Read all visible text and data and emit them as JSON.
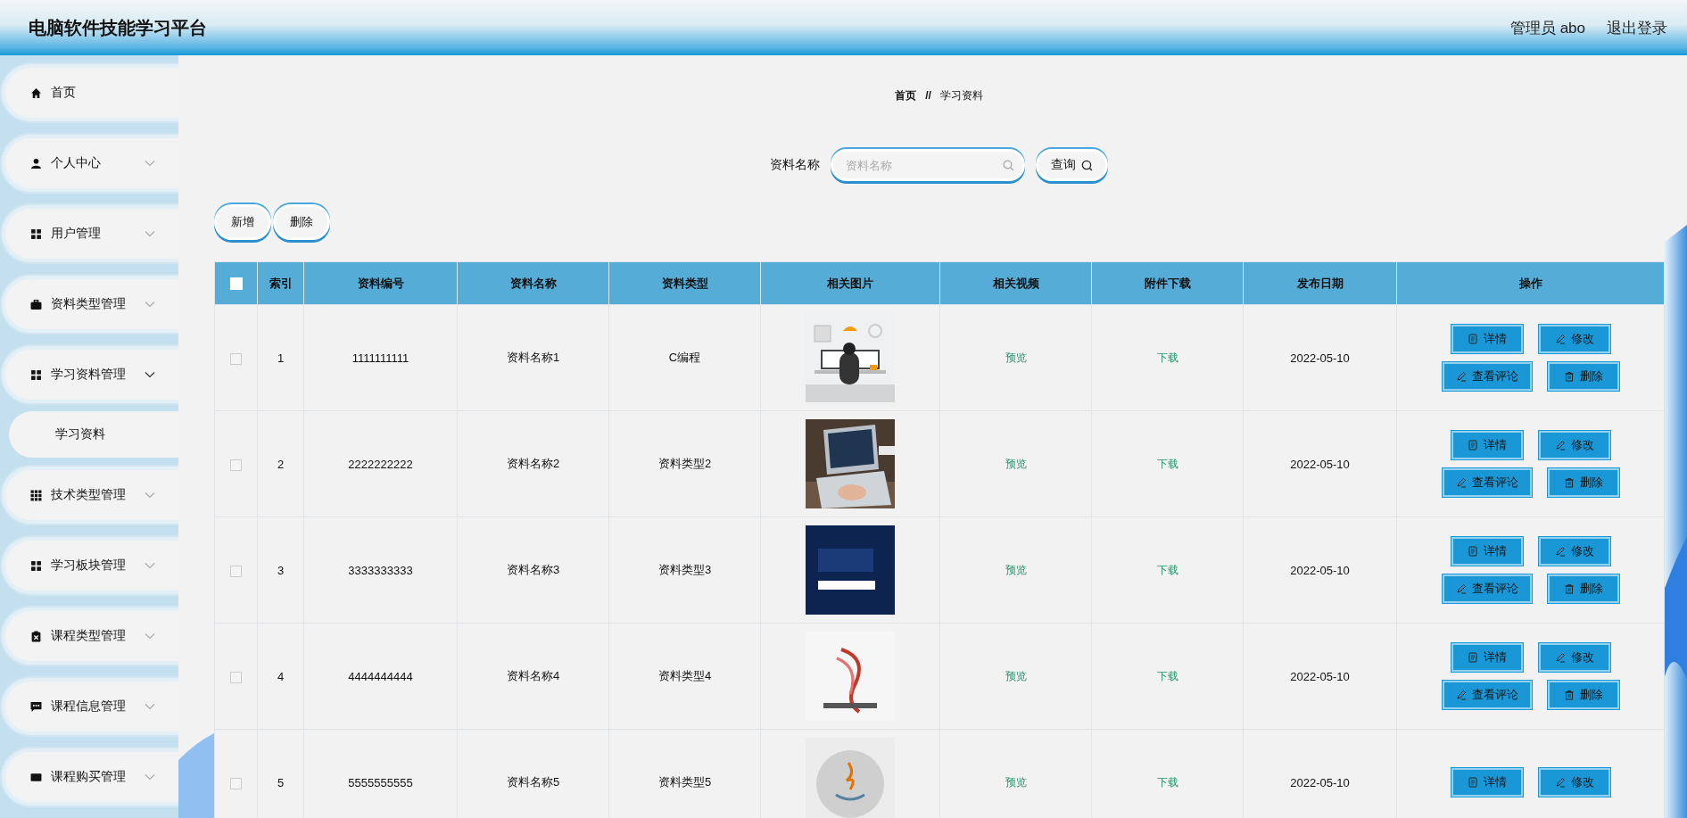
{
  "header": {
    "title": "电脑软件技能学习平台",
    "user": "管理员 abo",
    "logout": "退出登录"
  },
  "sidebar": {
    "items": [
      {
        "label": "首页",
        "kind": "link"
      },
      {
        "label": "个人中心",
        "kind": "menu",
        "expanded": false
      },
      {
        "label": "用户管理",
        "kind": "menu",
        "expanded": false
      },
      {
        "label": "资料类型管理",
        "kind": "menu",
        "expanded": false
      },
      {
        "label": "学习资料管理",
        "kind": "menu",
        "expanded": true,
        "children": [
          {
            "label": "学习资料",
            "selected": true
          }
        ]
      },
      {
        "label": "技术类型管理",
        "kind": "menu",
        "expanded": false
      },
      {
        "label": "学习板块管理",
        "kind": "menu",
        "expanded": false
      },
      {
        "label": "课程类型管理",
        "kind": "menu",
        "expanded": false
      },
      {
        "label": "课程信息管理",
        "kind": "menu",
        "expanded": false
      },
      {
        "label": "课程购买管理",
        "kind": "menu",
        "expanded": false
      }
    ]
  },
  "breadcrumb": {
    "items": [
      "首页",
      "学习资料"
    ],
    "separator": "//"
  },
  "search": {
    "label": "资料名称",
    "placeholder": "资料名称",
    "button": "查询"
  },
  "toolbar": [
    "新增",
    "删除"
  ],
  "table": {
    "select_all": {
      "checked": false
    },
    "columns": [
      "索引",
      "资料编号",
      "资料名称",
      "资料类型",
      "相关图片",
      "相关视频",
      "附件下载",
      "发布日期",
      "操作"
    ],
    "rows": [
      {
        "checked": false,
        "index": "1",
        "code": "1111111111",
        "name": "资料名称1",
        "type": "C编程",
        "picture": {
          "kind": "picture"
        },
        "video": "预览",
        "file": "下载",
        "date": "2022-05-10",
        "actions": [
          {
            "kind": "detail",
            "label": "详情"
          },
          {
            "kind": "edit",
            "label": "修改"
          },
          {
            "kind": "comment",
            "label": "查看评论"
          },
          {
            "kind": "delete",
            "label": "删除"
          }
        ]
      },
      {
        "checked": false,
        "index": "2",
        "code": "2222222222",
        "name": "资料名称2",
        "type": "资料类型2",
        "picture": {
          "kind": "picture"
        },
        "video": "预览",
        "file": "下载",
        "date": "2022-05-10",
        "actions": [
          {
            "kind": "detail",
            "label": "详情"
          },
          {
            "kind": "edit",
            "label": "修改"
          },
          {
            "kind": "comment",
            "label": "查看评论"
          },
          {
            "kind": "delete",
            "label": "删除"
          }
        ]
      },
      {
        "checked": false,
        "index": "3",
        "code": "3333333333",
        "name": "资料名称3",
        "type": "资料类型3",
        "picture": {
          "kind": "picture"
        },
        "video": "预览",
        "file": "下载",
        "date": "2022-05-10",
        "actions": [
          {
            "kind": "detail",
            "label": "详情"
          },
          {
            "kind": "edit",
            "label": "修改"
          },
          {
            "kind": "comment",
            "label": "查看评论"
          },
          {
            "kind": "delete",
            "label": "删除"
          }
        ]
      },
      {
        "checked": false,
        "index": "4",
        "code": "4444444444",
        "name": "资料名称4",
        "type": "资料类型4",
        "picture": {
          "kind": "picture"
        },
        "video": "预览",
        "file": "下载",
        "date": "2022-05-10",
        "actions": [
          {
            "kind": "detail",
            "label": "详情"
          },
          {
            "kind": "edit",
            "label": "修改"
          },
          {
            "kind": "comment",
            "label": "查看评论"
          },
          {
            "kind": "delete",
            "label": "删除"
          }
        ]
      },
      {
        "checked": false,
        "index": "5",
        "code": "5555555555",
        "name": "资料名称5",
        "type": "资料类型5",
        "picture": {
          "kind": "picture"
        },
        "video": "预览",
        "file": "下载",
        "date": "2022-05-10",
        "actions": [
          {
            "kind": "detail",
            "label": "详情"
          },
          {
            "kind": "edit",
            "label": "修改"
          }
        ]
      }
    ]
  }
}
